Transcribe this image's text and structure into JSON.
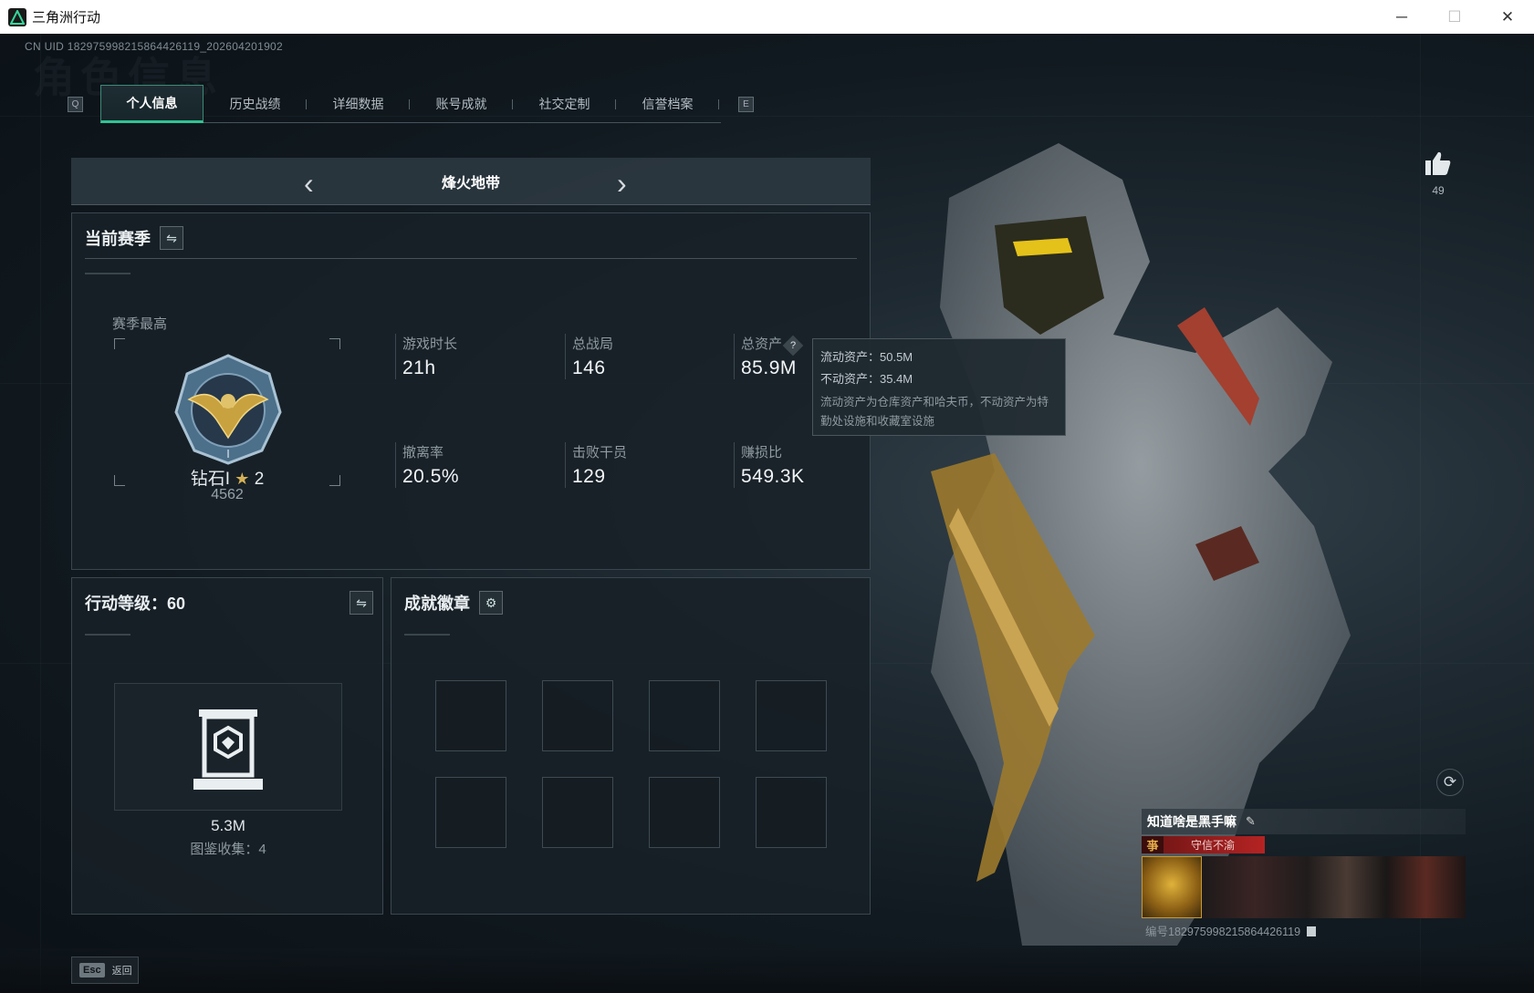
{
  "window": {
    "title": "三角洲行动",
    "minimize": "─",
    "maximize": "☐",
    "close": "✕"
  },
  "uid_text": "CN UID 1829759982158644261​19_202604201902",
  "watermark": "角色信息",
  "tabs": {
    "left_key": "Q",
    "right_key": "E",
    "items": [
      "个人信息",
      "历史战绩",
      "详细数据",
      "账号成就",
      "社交定制",
      "信誉档案"
    ],
    "active": 0
  },
  "mode": {
    "name": "烽火地带",
    "prev": "‹",
    "next": "›"
  },
  "season": {
    "title": "当前赛季",
    "swap_icon": "⇋",
    "best_label": "赛季最高",
    "rank": "钻石I",
    "rank_stars": "2",
    "rank_score": "4562",
    "stats": [
      {
        "label": "游戏时长",
        "value": "21h"
      },
      {
        "label": "总战局",
        "value": "146"
      },
      {
        "label": "总资产",
        "value": "85.9M"
      },
      {
        "label": "撤离率",
        "value": "20.5%"
      },
      {
        "label": "击败干员",
        "value": "129"
      },
      {
        "label": "赚损比",
        "value": "549.3K"
      }
    ]
  },
  "tooltip": {
    "liquid": "流动资产：50.5M",
    "fixed": "不动资产：35.4M",
    "desc": "流动资产为仓库资产和哈夫币，不动资产为特勤处设施和收藏室设施"
  },
  "level": {
    "title": "行动等级：60",
    "value": "5.3M",
    "collection": "图鉴收集：4"
  },
  "badges": {
    "title": "成就徽章",
    "gear_icon": "⚙"
  },
  "like_count": "49",
  "player_card": {
    "name": "知道啥是黑手嘛",
    "edit_icon": "✎",
    "tag": "守信不渝",
    "tag_icon": "亊",
    "id_text": "编号1829759982158644261​19"
  },
  "esc": {
    "key": "Esc",
    "label": "返回"
  },
  "colors": {
    "accent": "#30c393",
    "tag_red": "#b52323"
  }
}
